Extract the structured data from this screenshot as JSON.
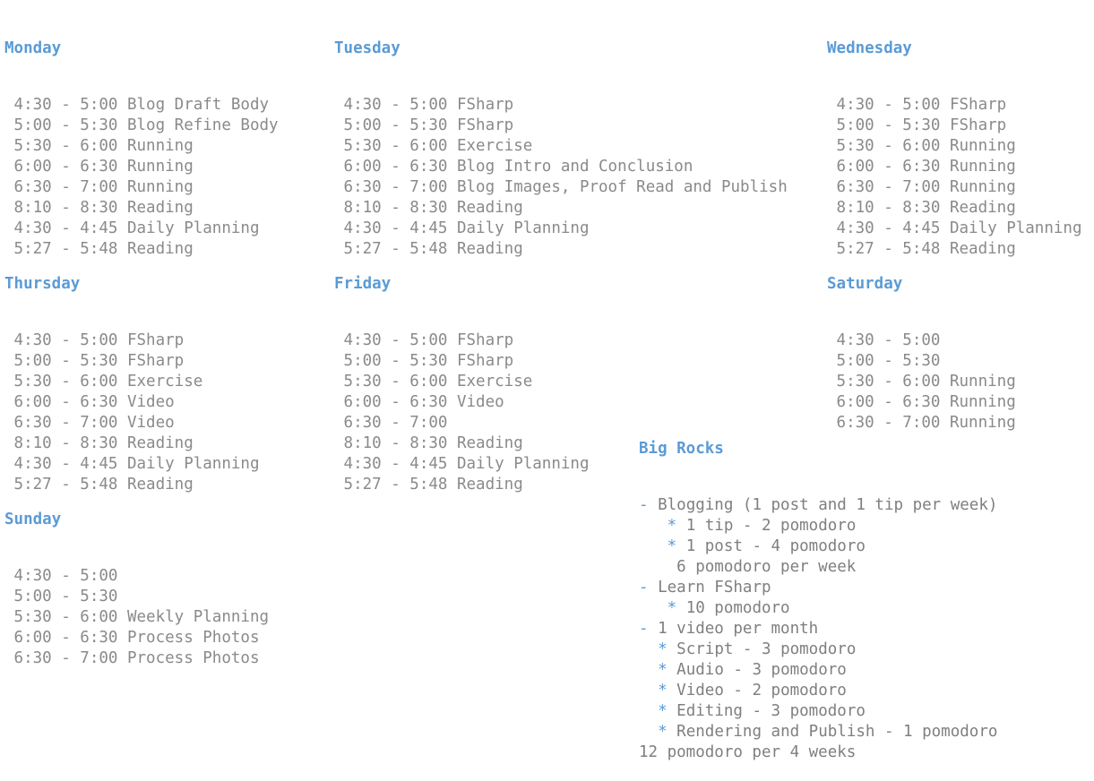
{
  "days": {
    "monday": {
      "title": "Monday",
      "entries": [
        {
          "time": " 4:30 - 5:00",
          "task": "Blog Draft Body"
        },
        {
          "time": " 5:00 - 5:30",
          "task": "Blog Refine Body"
        },
        {
          "time": " 5:30 - 6:00",
          "task": "Running"
        },
        {
          "time": " 6:00 - 6:30",
          "task": "Running"
        },
        {
          "time": " 6:30 - 7:00",
          "task": "Running"
        },
        {
          "time": " 8:10 - 8:30",
          "task": "Reading"
        },
        {
          "time": " 4:30 - 4:45",
          "task": "Daily Planning"
        },
        {
          "time": " 5:27 - 5:48",
          "task": "Reading"
        }
      ]
    },
    "tuesday": {
      "title": "Tuesday",
      "entries": [
        {
          "time": " 4:30 - 5:00",
          "task": "FSharp"
        },
        {
          "time": " 5:00 - 5:30",
          "task": "FSharp"
        },
        {
          "time": " 5:30 - 6:00",
          "task": "Exercise"
        },
        {
          "time": " 6:00 - 6:30",
          "task": "Blog Intro and Conclusion"
        },
        {
          "time": " 6:30 - 7:00",
          "task": "Blog Images, Proof Read and Publish"
        },
        {
          "time": " 8:10 - 8:30",
          "task": "Reading"
        },
        {
          "time": " 4:30 - 4:45",
          "task": "Daily Planning"
        },
        {
          "time": " 5:27 - 5:48",
          "task": "Reading"
        }
      ]
    },
    "wednesday": {
      "title": "Wednesday",
      "entries": [
        {
          "time": " 4:30 - 5:00",
          "task": "FSharp"
        },
        {
          "time": " 5:00 - 5:30",
          "task": "FSharp"
        },
        {
          "time": " 5:30 - 6:00",
          "task": "Running"
        },
        {
          "time": " 6:00 - 6:30",
          "task": "Running"
        },
        {
          "time": " 6:30 - 7:00",
          "task": "Running"
        },
        {
          "time": " 8:10 - 8:30",
          "task": "Reading"
        },
        {
          "time": " 4:30 - 4:45",
          "task": "Daily Planning"
        },
        {
          "time": " 5:27 - 5:48",
          "task": "Reading"
        }
      ]
    },
    "thursday": {
      "title": "Thursday",
      "entries": [
        {
          "time": " 4:30 - 5:00",
          "task": "FSharp"
        },
        {
          "time": " 5:00 - 5:30",
          "task": "FSharp"
        },
        {
          "time": " 5:30 - 6:00",
          "task": "Exercise"
        },
        {
          "time": " 6:00 - 6:30",
          "task": "Video"
        },
        {
          "time": " 6:30 - 7:00",
          "task": "Video"
        },
        {
          "time": " 8:10 - 8:30",
          "task": "Reading"
        },
        {
          "time": " 4:30 - 4:45",
          "task": "Daily Planning"
        },
        {
          "time": " 5:27 - 5:48",
          "task": "Reading"
        }
      ]
    },
    "friday": {
      "title": "Friday",
      "entries": [
        {
          "time": " 4:30 - 5:00",
          "task": "FSharp"
        },
        {
          "time": " 5:00 - 5:30",
          "task": "FSharp"
        },
        {
          "time": " 5:30 - 6:00",
          "task": "Exercise"
        },
        {
          "time": " 6:00 - 6:30",
          "task": "Video"
        },
        {
          "time": " 6:30 - 7:00",
          "task": ""
        },
        {
          "time": " 8:10 - 8:30",
          "task": "Reading"
        },
        {
          "time": " 4:30 - 4:45",
          "task": "Daily Planning"
        },
        {
          "time": " 5:27 - 5:48",
          "task": "Reading"
        }
      ]
    },
    "saturday": {
      "title": "Saturday",
      "entries": [
        {
          "time": " 4:30 - 5:00",
          "task": ""
        },
        {
          "time": " 5:00 - 5:30",
          "task": ""
        },
        {
          "time": " 5:30 - 6:00",
          "task": "Running"
        },
        {
          "time": " 6:00 - 6:30",
          "task": "Running"
        },
        {
          "time": " 6:30 - 7:00",
          "task": "Running"
        }
      ]
    },
    "sunday": {
      "title": "Sunday",
      "entries": [
        {
          "time": " 4:30 - 5:00",
          "task": ""
        },
        {
          "time": " 5:00 - 5:30",
          "task": ""
        },
        {
          "time": " 5:30 - 6:00",
          "task": "Weekly Planning"
        },
        {
          "time": " 6:00 - 6:30",
          "task": "Process Photos"
        },
        {
          "time": " 6:30 - 7:00",
          "task": "Process Photos"
        }
      ]
    }
  },
  "big_rocks": {
    "title": "Big Rocks",
    "lines": [
      {
        "indent": "",
        "bullet": "-",
        "text": "Blogging (1 post and 1 tip per week)"
      },
      {
        "indent": "   ",
        "bullet": "*",
        "text": "1 tip - 2 pomodoro"
      },
      {
        "indent": "   ",
        "bullet": "*",
        "text": "1 post - 4 pomodoro"
      },
      {
        "indent": "   ",
        "bullet": "",
        "text": " 6 pomodoro per week"
      },
      {
        "indent": "",
        "bullet": "-",
        "text": "Learn FSharp"
      },
      {
        "indent": "   ",
        "bullet": "*",
        "text": "10 pomodoro"
      },
      {
        "indent": "",
        "bullet": "-",
        "text": "1 video per month"
      },
      {
        "indent": "  ",
        "bullet": "*",
        "text": "Script - 3 pomodoro"
      },
      {
        "indent": "  ",
        "bullet": "*",
        "text": "Audio - 3 pomodoro"
      },
      {
        "indent": "  ",
        "bullet": "*",
        "text": "Video - 2 pomodoro"
      },
      {
        "indent": "  ",
        "bullet": "*",
        "text": "Editing - 3 pomodoro"
      },
      {
        "indent": "  ",
        "bullet": "*",
        "text": "Rendering and Publish - 1 pomodoro"
      },
      {
        "indent": "",
        "bullet": "",
        "text": "12 pomodoro per 4 weeks"
      }
    ]
  },
  "colors": {
    "heading": "#5b9bd5",
    "text": "#7f7f7f",
    "background": "#ffffff"
  }
}
